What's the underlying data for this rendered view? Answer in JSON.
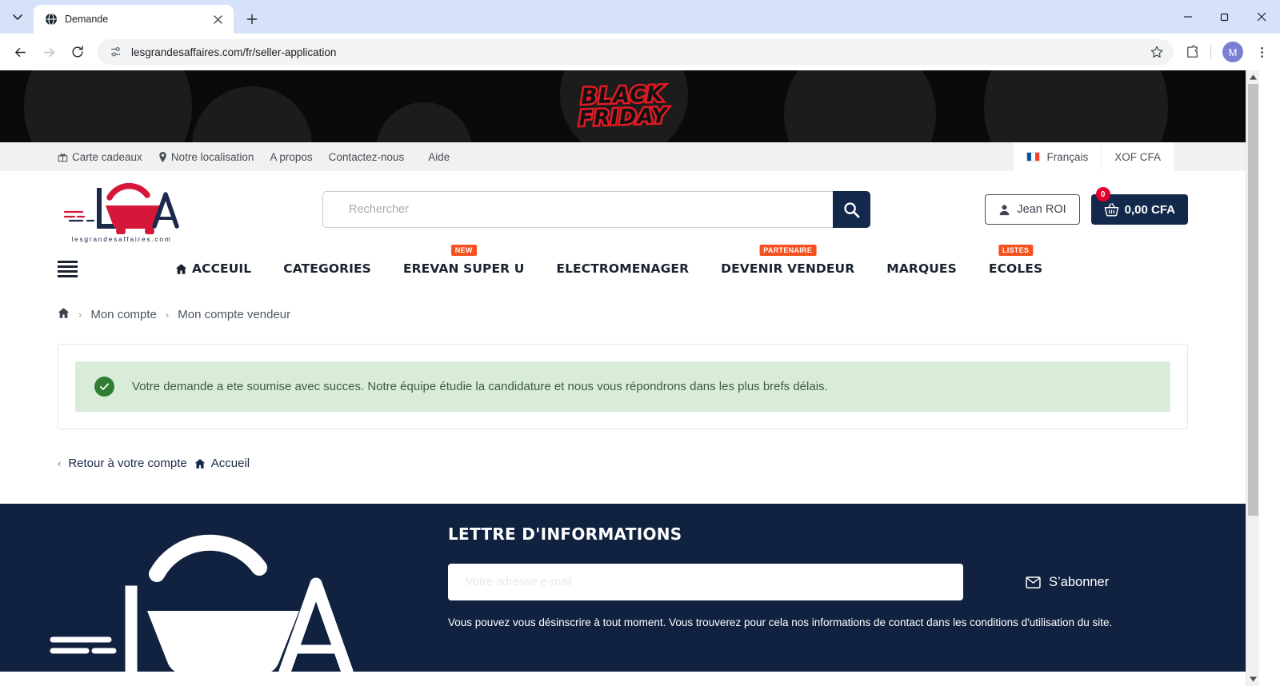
{
  "browser": {
    "tab": {
      "title": "Demande",
      "favicon_icon": "globe-icon",
      "close_icon": "close-icon"
    },
    "tab_list_icon": "chevron-down-icon",
    "new_tab_icon": "plus-icon",
    "window": {
      "minimize": "minimize-icon",
      "maximize": "maximize-icon",
      "close": "close-icon"
    },
    "nav": {
      "back_icon": "arrow-left-icon",
      "forward_icon": "arrow-right-icon",
      "reload_icon": "reload-icon"
    },
    "omnibox": {
      "url": "lesgrandesaffaires.com/fr/seller-application",
      "site_info_icon": "tune-icon",
      "bookmark_icon": "star-icon",
      "extensions_icon": "puzzle-icon",
      "menu_icon": "kebab-menu-icon",
      "profile_initial": "M"
    },
    "scrollbar": {
      "up_icon": "caret-up-icon",
      "down_icon": "caret-down-icon"
    }
  },
  "banner": {
    "line1": "BLACK",
    "line2": "FRIDAY",
    "bg_color": "#0a0a0a",
    "accent_color": "#e01b24"
  },
  "topbar": {
    "links": [
      {
        "label": "Carte cadeaux",
        "icon": "gift-icon"
      },
      {
        "label": "Notre localisation",
        "icon": "map-pin-icon"
      },
      {
        "label": "A propos",
        "icon": ""
      },
      {
        "label": "Contactez-nous",
        "icon": ""
      },
      {
        "label": "Aide",
        "icon": ""
      }
    ],
    "language": "Français",
    "currency": "XOF CFA"
  },
  "header": {
    "logo": {
      "letters": "LGA",
      "domain": "lesgrandesaffaires.com",
      "cart_color": "#d6173a",
      "text_color": "#1b2a4a"
    },
    "search": {
      "placeholder": "Rechercher",
      "value": "",
      "button_icon": "search-icon"
    },
    "account": {
      "label": "Jean ROI",
      "icon": "user-icon"
    },
    "cart": {
      "amount": "0,00 CFA",
      "count": "0",
      "icon": "basket-icon"
    }
  },
  "nav": {
    "burger_icon": "hamburger-menu-icon",
    "items": [
      {
        "label": "ACCEUIL",
        "icon": "home-icon",
        "badge": ""
      },
      {
        "label": "CATEGORIES",
        "icon": "",
        "badge": ""
      },
      {
        "label": "EREVAN SUPER U",
        "icon": "",
        "badge": "NEW"
      },
      {
        "label": "ELECTROMENAGER",
        "icon": "",
        "badge": ""
      },
      {
        "label": "DEVENIR VENDEUR",
        "icon": "",
        "badge": "PARTENAIRE"
      },
      {
        "label": "MARQUES",
        "icon": "",
        "badge": ""
      },
      {
        "label": "ECOLES",
        "icon": "",
        "badge": "LISTES"
      }
    ]
  },
  "breadcrumb": {
    "home_icon": "home-icon",
    "items": [
      "Mon compte",
      "Mon compte vendeur"
    ]
  },
  "alert": {
    "icon": "check-circle-icon",
    "message": "Votre demande a ete soumise avec succes. Notre équipe étudie la candidature et nous vous répondrons dans les plus brefs délais.",
    "bg_color": "#d9ecd9",
    "icon_color": "#2f7d32"
  },
  "page_links": {
    "back_chevron": "chevron-left-icon",
    "back_label": "Retour à votre compte",
    "home_icon": "home-icon",
    "home_label": "Accueil"
  },
  "footer": {
    "bg_color": "#112240",
    "logo_letters": "LGA",
    "newsletter": {
      "title": "LETTRE D'INFORMATIONS",
      "placeholder": "Votre adresse e-mail",
      "value": "",
      "subscribe_label": "S’abonner",
      "subscribe_icon": "envelope-icon",
      "note": "Vous pouvez vous désinscrire à tout moment. Vous trouverez pour cela nos informations de contact dans les conditions d'utilisation du site."
    }
  }
}
